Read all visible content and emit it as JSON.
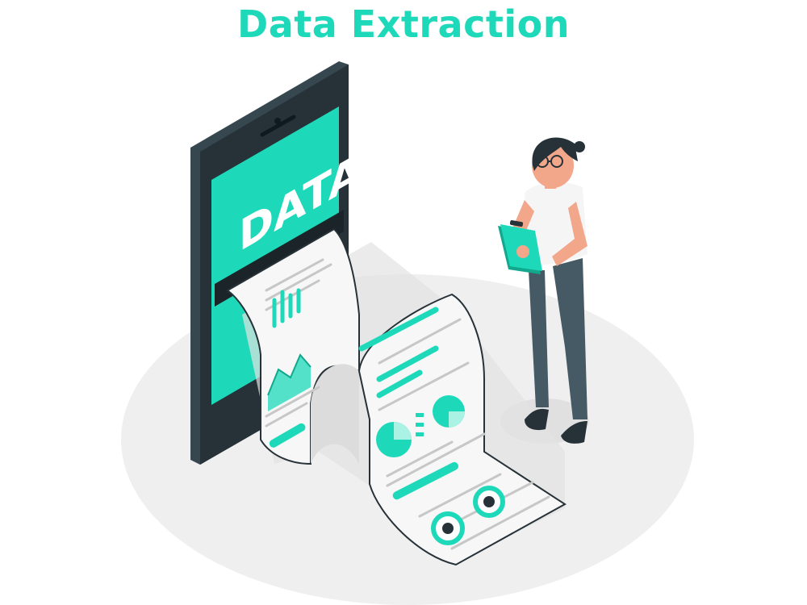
{
  "title": "Data Extraction",
  "screen_text": "DATA",
  "colors": {
    "accent": "#1ed9b9",
    "accent_dark": "#12a88e",
    "phone_body": "#263238",
    "phone_side": "#37474f",
    "floor": "#efefef",
    "paper": "#f7f7f7",
    "paper_line": "#c7c7c7",
    "skin": "#f2a68a",
    "pants": "#455a64",
    "shirt": "#f5f5f5"
  },
  "icons": [
    "phone-icon",
    "paper-report-icon",
    "clipboard-icon",
    "person-icon",
    "glasses-icon"
  ]
}
